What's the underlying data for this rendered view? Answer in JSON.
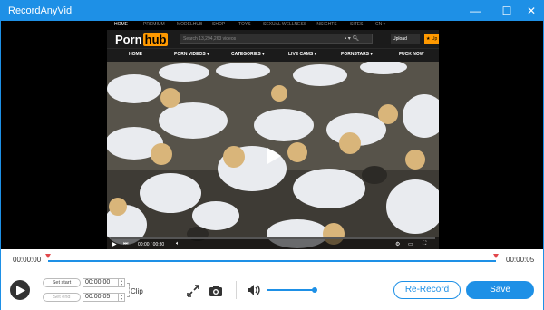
{
  "window": {
    "title": "RecordAnyVid",
    "minimize_glyph": "—",
    "maximize_glyph": "☐",
    "close_glyph": "✕"
  },
  "website": {
    "topnav": [
      "HOME",
      "PREMIUM",
      "MODELHUB",
      "SHOP",
      "TOYS",
      "SEXUAL WELLNESS",
      "INSIGHTS",
      "SITES",
      "CN ▾"
    ],
    "logo_part1": "Porn",
    "logo_part2": "hub",
    "search_placeholder": "Search 13,294,263 videos",
    "upload_label": "Upload",
    "upgrade_label": "★ Up",
    "categories": [
      "HOME",
      "PORN VIDEOS ▾",
      "CATEGORIES ▾",
      "LIVE CAMS ▾",
      "PORNSTARS ▾",
      "FUCK NOW"
    ],
    "video_time": "00:00 / 00:30"
  },
  "timeline": {
    "start_time": "00:00:00",
    "end_time": "00:00:05",
    "clip_start_fraction": 0.0,
    "clip_end_fraction": 1.0
  },
  "controls": {
    "set_start_label": "Set start",
    "set_start_value": "00:00:00",
    "set_end_label": "Set end",
    "set_end_value": "00:00:05",
    "clip_label": "Clip",
    "volume_level": 1.0,
    "rerecord_label": "Re-Record",
    "save_label": "Save"
  },
  "icons": [
    "play-icon",
    "fullscreen-icon",
    "camera-icon",
    "volume-icon"
  ],
  "colors": {
    "accent": "#1e90e6",
    "marker": "#e2474b",
    "brand_orange": "#ff9900"
  }
}
